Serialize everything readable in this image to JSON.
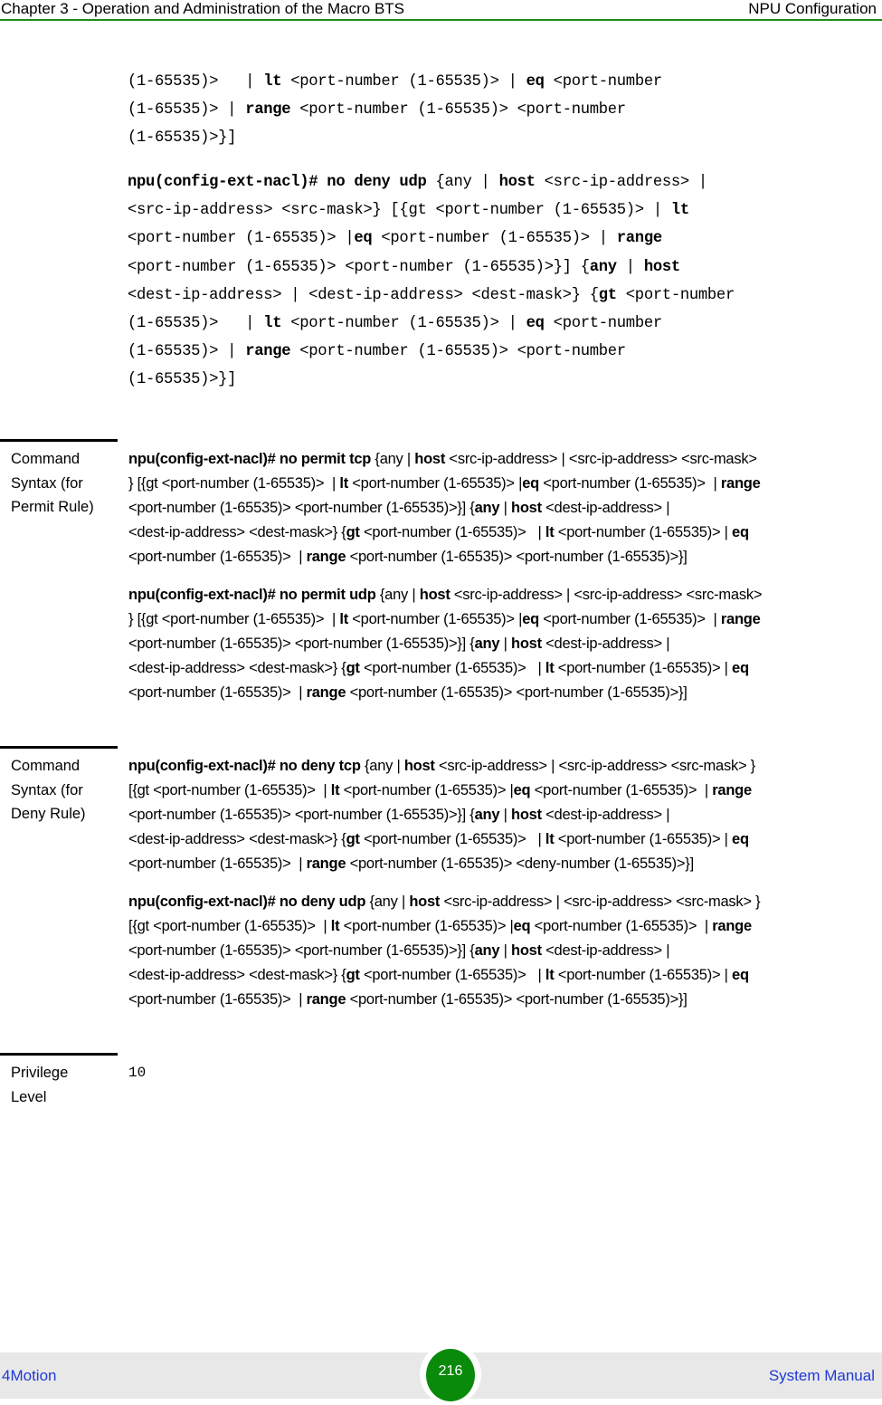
{
  "header": {
    "chapter_title": "Chapter 3 - Operation and Administration of the Macro BTS",
    "section_title": "NPU Configuration"
  },
  "continued_block": {
    "lines": [
      [
        {
          "t": "(1-65535)>   | ",
          "b": false
        },
        {
          "t": "lt",
          "b": true
        },
        {
          "t": " <port-number (1-65535)> | ",
          "b": false
        },
        {
          "t": "eq",
          "b": true
        },
        {
          "t": " <port-number",
          "b": false
        }
      ],
      [
        {
          "t": "(1-65535)> | ",
          "b": false
        },
        {
          "t": "range",
          "b": true
        },
        {
          "t": " <port-number (1-65535)> <port-number",
          "b": false
        }
      ],
      [
        {
          "t": "(1-65535)>}]",
          "b": false
        }
      ]
    ]
  },
  "deny_udp_block": {
    "lines": [
      [
        {
          "t": "npu(config-ext-nacl)# no deny udp",
          "b": true
        },
        {
          "t": " {any | ",
          "b": false
        },
        {
          "t": "host",
          "b": true
        },
        {
          "t": " <src-ip-address> |",
          "b": false
        }
      ],
      [
        {
          "t": "<src-ip-address> <src-mask>} [{gt <port-number (1-65535)> | ",
          "b": false
        },
        {
          "t": "lt",
          "b": true
        }
      ],
      [
        {
          "t": "<port-number (1-65535)> |",
          "b": false
        },
        {
          "t": "eq",
          "b": true
        },
        {
          "t": " <port-number (1-65535)> | ",
          "b": false
        },
        {
          "t": "range",
          "b": true
        }
      ],
      [
        {
          "t": "<port-number (1-65535)> <port-number (1-65535)>}] {",
          "b": false
        },
        {
          "t": "any",
          "b": true
        },
        {
          "t": " | ",
          "b": false
        },
        {
          "t": "host",
          "b": true
        }
      ],
      [
        {
          "t": "<dest-ip-address> | <dest-ip-address> <dest-mask>} {",
          "b": false
        },
        {
          "t": "gt",
          "b": true
        },
        {
          "t": " <port-number",
          "b": false
        }
      ],
      [
        {
          "t": "(1-65535)>   | ",
          "b": false
        },
        {
          "t": "lt",
          "b": true
        },
        {
          "t": " <port-number (1-65535)> | ",
          "b": false
        },
        {
          "t": "eq",
          "b": true
        },
        {
          "t": " <port-number",
          "b": false
        }
      ],
      [
        {
          "t": "(1-65535)> | ",
          "b": false
        },
        {
          "t": "range",
          "b": true
        },
        {
          "t": " <port-number (1-65535)> <port-number",
          "b": false
        }
      ],
      [
        {
          "t": "(1-65535)>}]",
          "b": false
        }
      ]
    ]
  },
  "sections": [
    {
      "label": "Command Syntax (for Permit Rule)",
      "label_lines": [
        "Command",
        "Syntax (for",
        "Permit Rule)"
      ],
      "commands": [
        {
          "lines": [
            [
              {
                "t": "npu(config-ext-nacl)# no permit tcp",
                "b": true
              },
              {
                "t": " {any | ",
                "b": false
              },
              {
                "t": "host",
                "b": true
              },
              {
                "t": " <src-ip-address> | <src-ip-address> <src-mask>",
                "b": false
              }
            ],
            [
              {
                "t": "} [{gt <port-number (1-65535)>  | ",
                "b": false
              },
              {
                "t": "lt",
                "b": true
              },
              {
                "t": " <port-number (1-65535)> |",
                "b": false
              },
              {
                "t": "eq",
                "b": true
              },
              {
                "t": " <port-number (1-65535)>  | ",
                "b": false
              },
              {
                "t": "range",
                "b": true
              }
            ],
            [
              {
                "t": "<port-number (1-65535)> <port-number (1-65535)>}] {",
                "b": false
              },
              {
                "t": "any",
                "b": true
              },
              {
                "t": " | ",
                "b": false
              },
              {
                "t": "host",
                "b": true
              },
              {
                "t": " <dest-ip-address> |",
                "b": false
              }
            ],
            [
              {
                "t": "<dest-ip-address> <dest-mask>} {",
                "b": false
              },
              {
                "t": "gt",
                "b": true
              },
              {
                "t": " <port-number (1-65535)>   | ",
                "b": false
              },
              {
                "t": "lt",
                "b": true
              },
              {
                "t": " <port-number (1-65535)> | ",
                "b": false
              },
              {
                "t": "eq",
                "b": true
              }
            ],
            [
              {
                "t": "<port-number (1-65535)>  | ",
                "b": false
              },
              {
                "t": "range",
                "b": true
              },
              {
                "t": " <port-number (1-65535)> <port-number (1-65535)>}]",
                "b": false
              }
            ]
          ]
        },
        {
          "lines": [
            [
              {
                "t": "npu(config-ext-nacl)# no permit udp",
                "b": true
              },
              {
                "t": " {any | ",
                "b": false
              },
              {
                "t": "host",
                "b": true
              },
              {
                "t": " <src-ip-address> | <src-ip-address> <src-mask>",
                "b": false
              }
            ],
            [
              {
                "t": "} [{gt <port-number (1-65535)>  | ",
                "b": false
              },
              {
                "t": "lt",
                "b": true
              },
              {
                "t": " <port-number (1-65535)> |",
                "b": false
              },
              {
                "t": "eq",
                "b": true
              },
              {
                "t": " <port-number (1-65535)>  | ",
                "b": false
              },
              {
                "t": "range",
                "b": true
              }
            ],
            [
              {
                "t": "<port-number (1-65535)> <port-number (1-65535)>}] {",
                "b": false
              },
              {
                "t": "any",
                "b": true
              },
              {
                "t": " | ",
                "b": false
              },
              {
                "t": "host",
                "b": true
              },
              {
                "t": " <dest-ip-address> |",
                "b": false
              }
            ],
            [
              {
                "t": "<dest-ip-address> <dest-mask>} {",
                "b": false
              },
              {
                "t": "gt",
                "b": true
              },
              {
                "t": " <port-number (1-65535)>   | ",
                "b": false
              },
              {
                "t": "lt",
                "b": true
              },
              {
                "t": " <port-number (1-65535)> | ",
                "b": false
              },
              {
                "t": "eq",
                "b": true
              }
            ],
            [
              {
                "t": "<port-number (1-65535)>  | ",
                "b": false
              },
              {
                "t": "range",
                "b": true
              },
              {
                "t": " <port-number (1-65535)> <port-number (1-65535)>}]",
                "b": false
              }
            ]
          ]
        }
      ]
    },
    {
      "label": "Command Syntax (for Deny Rule)",
      "label_lines": [
        "Command",
        "Syntax (for",
        "Deny Rule)"
      ],
      "commands": [
        {
          "lines": [
            [
              {
                "t": "npu(config-ext-nacl)# no deny tcp",
                "b": true
              },
              {
                "t": " {any | ",
                "b": false
              },
              {
                "t": "host",
                "b": true
              },
              {
                "t": " <src-ip-address> | <src-ip-address> <src-mask> }",
                "b": false
              }
            ],
            [
              {
                "t": "[{gt <port-number (1-65535)>  | ",
                "b": false
              },
              {
                "t": "lt",
                "b": true
              },
              {
                "t": " <port-number (1-65535)> |",
                "b": false
              },
              {
                "t": "eq",
                "b": true
              },
              {
                "t": " <port-number (1-65535)>  | ",
                "b": false
              },
              {
                "t": "range",
                "b": true
              }
            ],
            [
              {
                "t": "<port-number (1-65535)> <port-number (1-65535)>}] {",
                "b": false
              },
              {
                "t": "any",
                "b": true
              },
              {
                "t": " | ",
                "b": false
              },
              {
                "t": "host",
                "b": true
              },
              {
                "t": " <dest-ip-address> |",
                "b": false
              }
            ],
            [
              {
                "t": "<dest-ip-address> <dest-mask>} {",
                "b": false
              },
              {
                "t": "gt",
                "b": true
              },
              {
                "t": " <port-number (1-65535)>   | ",
                "b": false
              },
              {
                "t": "lt",
                "b": true
              },
              {
                "t": " <port-number (1-65535)> | ",
                "b": false
              },
              {
                "t": "eq",
                "b": true
              }
            ],
            [
              {
                "t": "<port-number (1-65535)>  | ",
                "b": false
              },
              {
                "t": "range",
                "b": true
              },
              {
                "t": " <port-number (1-65535)> <deny-number (1-65535)>}]",
                "b": false
              }
            ]
          ]
        },
        {
          "lines": [
            [
              {
                "t": "npu(config-ext-nacl)# no deny udp",
                "b": true
              },
              {
                "t": " {any | ",
                "b": false
              },
              {
                "t": "host",
                "b": true
              },
              {
                "t": " <src-ip-address> | <src-ip-address> <src-mask> }",
                "b": false
              }
            ],
            [
              {
                "t": "[{gt <port-number (1-65535)>  | ",
                "b": false
              },
              {
                "t": "lt",
                "b": true
              },
              {
                "t": " <port-number (1-65535)> |",
                "b": false
              },
              {
                "t": "eq",
                "b": true
              },
              {
                "t": " <port-number (1-65535)>  | ",
                "b": false
              },
              {
                "t": "range",
                "b": true
              }
            ],
            [
              {
                "t": "<port-number (1-65535)> <port-number (1-65535)>}] {",
                "b": false
              },
              {
                "t": "any",
                "b": true
              },
              {
                "t": " | ",
                "b": false
              },
              {
                "t": "host",
                "b": true
              },
              {
                "t": " <dest-ip-address> |",
                "b": false
              }
            ],
            [
              {
                "t": "<dest-ip-address> <dest-mask>} {",
                "b": false
              },
              {
                "t": "gt",
                "b": true
              },
              {
                "t": " <port-number (1-65535)>   | ",
                "b": false
              },
              {
                "t": "lt",
                "b": true
              },
              {
                "t": " <port-number (1-65535)> | ",
                "b": false
              },
              {
                "t": "eq",
                "b": true
              }
            ],
            [
              {
                "t": "<port-number (1-65535)>  | ",
                "b": false
              },
              {
                "t": "range",
                "b": true
              },
              {
                "t": " <port-number (1-65535)> <port-number (1-65535)>}]",
                "b": false
              }
            ]
          ]
        }
      ]
    }
  ],
  "privilege": {
    "label_lines": [
      "Privilege",
      "Level"
    ],
    "value": "10"
  },
  "footer": {
    "product": "4Motion",
    "page_number": "216",
    "doc_title": "System Manual"
  },
  "colors": {
    "header_rule": "#1a8a1a",
    "page_badge": "#0a8a0a",
    "footer_text": "#1f3ad6",
    "footer_bg": "#e8e8e8"
  }
}
